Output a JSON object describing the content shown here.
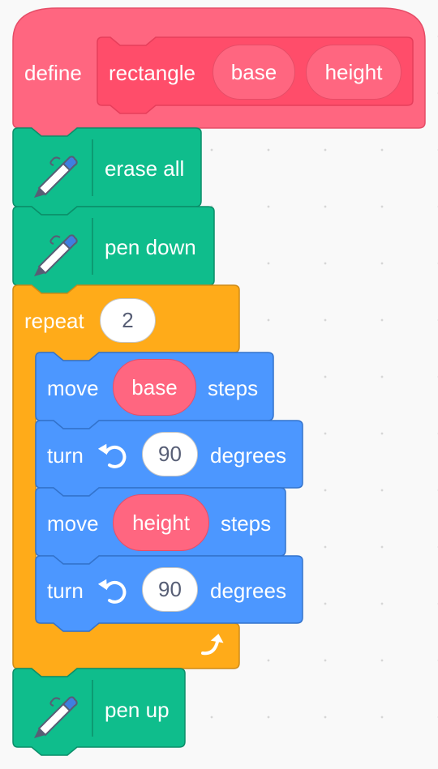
{
  "define": {
    "keyword": "define",
    "proc_name": "rectangle",
    "params": [
      "base",
      "height"
    ]
  },
  "blocks": {
    "erase_all": "erase all",
    "pen_down": "pen down",
    "repeat_label": "repeat",
    "repeat_count": "2",
    "move1": {
      "label": "move",
      "arg": "base",
      "suffix": "steps"
    },
    "turn1": {
      "label": "turn",
      "value": "90",
      "suffix": "degrees"
    },
    "move2": {
      "label": "move",
      "arg": "height",
      "suffix": "steps"
    },
    "turn2": {
      "label": "turn",
      "value": "90",
      "suffix": "degrees"
    },
    "pen_up": "pen up"
  },
  "icons": {
    "pen": "pen-icon",
    "turn": "rotate-left-icon",
    "loop": "loop-arrow-icon"
  },
  "colors": {
    "custom": "#ff6680",
    "custom_dark": "#ff4d6a",
    "pen": "#0fbd8c",
    "control": "#ffab19",
    "motion": "#4c97ff"
  }
}
